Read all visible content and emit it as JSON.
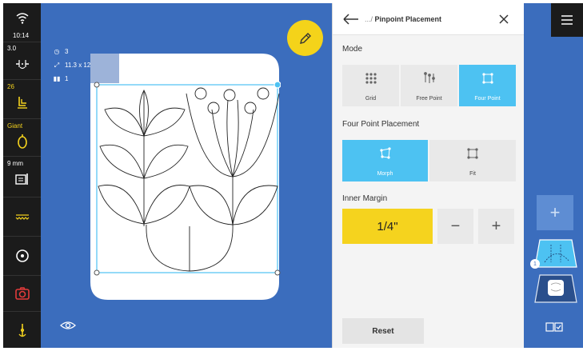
{
  "status": {
    "time": "10:14"
  },
  "sidebar": {
    "stitch_length": "3.0",
    "tension": "26",
    "presser_foot": "Giant",
    "width": "9 mm"
  },
  "canvas": {
    "info": {
      "count": "3",
      "size": "11.3 x 12.0 in",
      "layers": "1"
    }
  },
  "panel": {
    "breadcrumb_prefix": ".../",
    "title": "Pinpoint Placement",
    "mode_title": "Mode",
    "modes": [
      {
        "label": "Grid",
        "icon": "grid-icon"
      },
      {
        "label": "Free Point",
        "icon": "free-point-icon"
      },
      {
        "label": "Four Point",
        "icon": "four-point-icon",
        "selected": true
      }
    ],
    "placement_title": "Four Point Placement",
    "placements": [
      {
        "label": "Morph",
        "icon": "morph-icon",
        "selected": true
      },
      {
        "label": "Fit",
        "icon": "fit-icon"
      }
    ],
    "margin_title": "Inner Margin",
    "margin_value": "1/4\"",
    "minus": "−",
    "plus": "+",
    "reset_label": "Reset"
  },
  "strip": {
    "add_label": "+",
    "badge": "1"
  },
  "colors": {
    "accent_blue": "#4dc2f2",
    "canvas_blue": "#3b6dbd",
    "yellow": "#f5d31e",
    "dark": "#1b1b1b"
  }
}
